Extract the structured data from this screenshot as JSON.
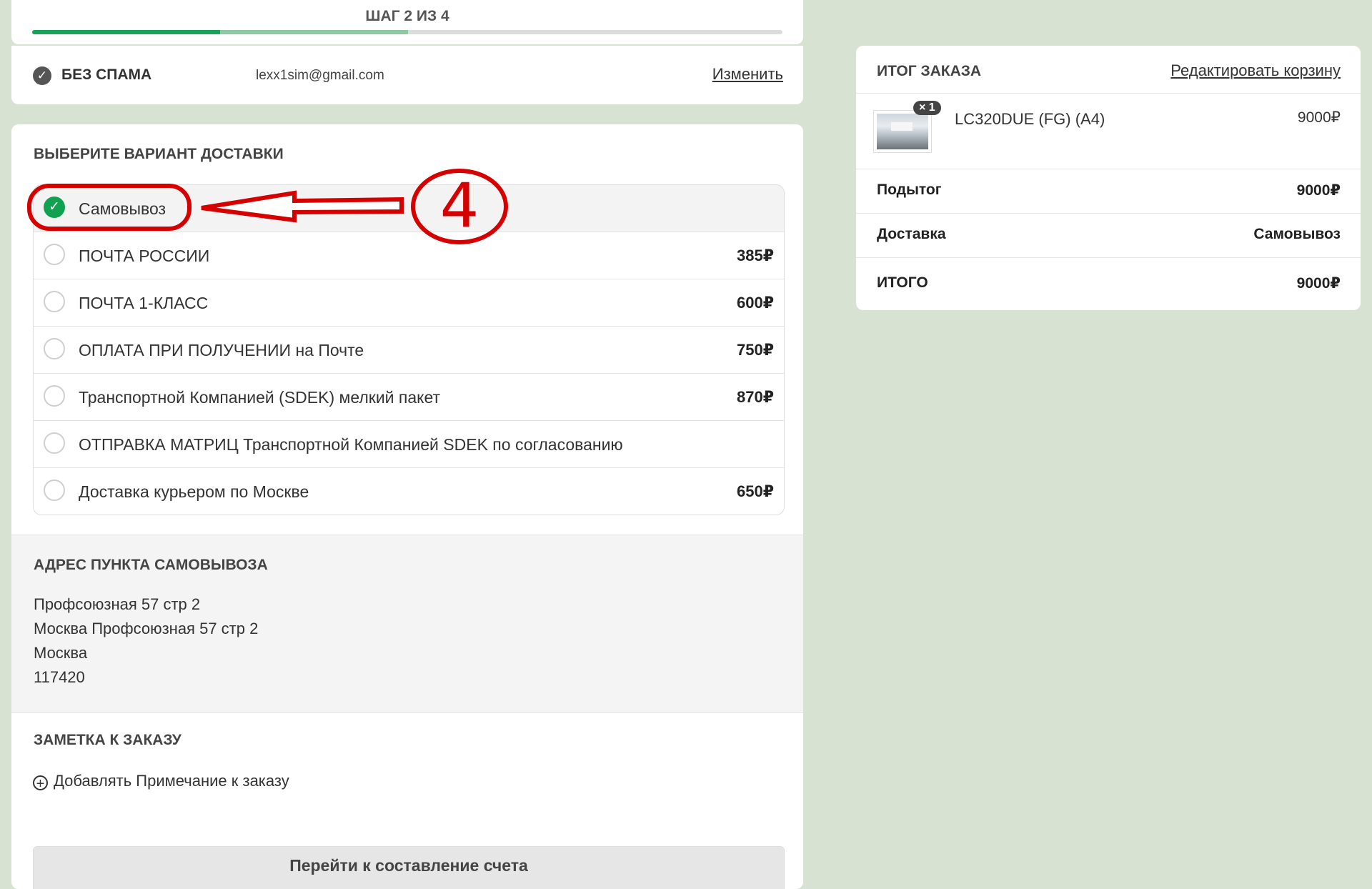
{
  "checkout": {
    "step_label": "ШАГ 2 ИЗ 4",
    "step_current": 2,
    "step_total": 4
  },
  "contact": {
    "check_icon": "check-circle-icon",
    "label": "БЕЗ СПАМА",
    "email": "lexx1sim@gmail.com",
    "change_link": "Изменить"
  },
  "shipping": {
    "title": "ВЫБЕРИТЕ ВАРИАНТ ДОСТАВКИ",
    "options": [
      {
        "label": "Самовывоз",
        "price": "",
        "selected": true
      },
      {
        "label": "ПОЧТА РОССИИ",
        "price": "385₽",
        "selected": false
      },
      {
        "label": "ПОЧТА 1-КЛАСС",
        "price": "600₽",
        "selected": false
      },
      {
        "label": "ОПЛАТА ПРИ ПОЛУЧЕНИИ на Почте",
        "price": "750₽",
        "selected": false
      },
      {
        "label": "Транспортной Компанией (SDEK) мелкий пакет",
        "price": "870₽",
        "selected": false
      },
      {
        "label": "ОТПРАВКА МАТРИЦ Транспортной Компанией SDEK по согласованию",
        "price": "",
        "selected": false
      },
      {
        "label": "Доставка курьером по Москве",
        "price": "650₽",
        "selected": false
      }
    ]
  },
  "pickup": {
    "title": "АДРЕС ПУНКТА САМОВЫВОЗА",
    "lines": [
      "Профсоюзная 57 стр 2",
      "Москва Профсоюзная 57 стр 2",
      "Москва",
      "117420"
    ]
  },
  "note": {
    "title": "ЗАМЕТКА К ЗАКАЗУ",
    "add_label": "Добавлять Примечание к заказу"
  },
  "submit": {
    "label": "Перейти к составление счета"
  },
  "summary": {
    "title": "ИТОГ ЗАКАЗА",
    "edit_cart": "Редактировать корзину",
    "item": {
      "qty": "× 1",
      "name": "LC320DUE (FG) (A4)",
      "price": "9000₽"
    },
    "subtotal_label": "Подытог",
    "subtotal_value": "9000₽",
    "shipping_label": "Доставка",
    "shipping_value": "Самовывоз",
    "total_label": "ИТОГО",
    "total_value": "9000₽"
  },
  "annotation": {
    "number": "4",
    "color": "#d50000"
  },
  "colors": {
    "accent": "#12a150",
    "background": "#d8e2d3"
  }
}
